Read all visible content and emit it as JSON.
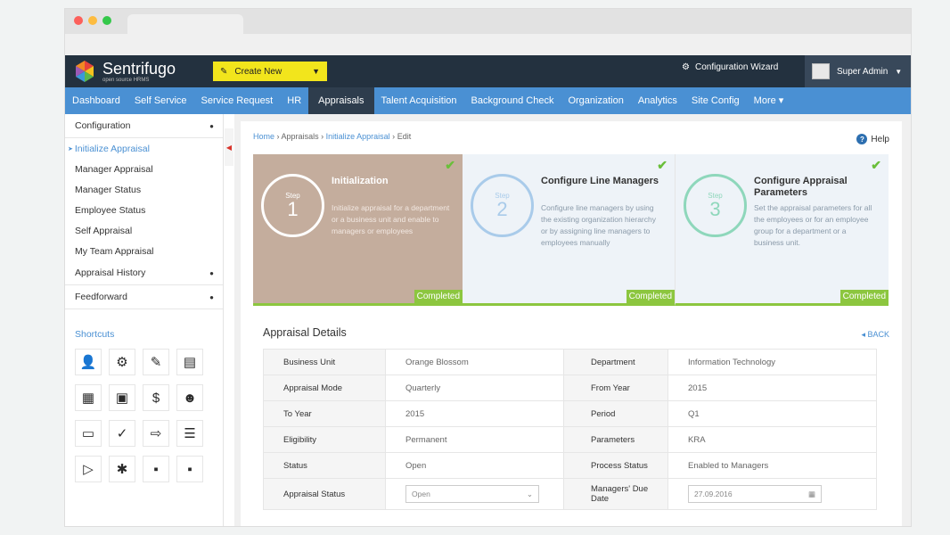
{
  "app": {
    "name": "Sentrifugo",
    "tagline": "open source HRMS"
  },
  "topbar": {
    "create_new": "Create New",
    "wizard": "Configuration Wizard",
    "user": "Super Admin"
  },
  "nav": [
    "Dashboard",
    "Self Service",
    "Service Request",
    "HR",
    "Appraisals",
    "Talent Acquisition",
    "Background Check",
    "Organization",
    "Analytics",
    "Site Config",
    "More ▾"
  ],
  "nav_active": "Appraisals",
  "sidebar": {
    "configuration": "Configuration",
    "initialize": "Initialize Appraisal",
    "items": [
      "Manager Appraisal",
      "Manager Status",
      "Employee Status",
      "Self Appraisal",
      "My Team Appraisal"
    ],
    "history": "Appraisal History",
    "feedforward": "Feedforward",
    "shortcuts": "Shortcuts"
  },
  "breadcrumb": {
    "home": "Home",
    "appraisals": "Appraisals",
    "initialize": "Initialize Appraisal",
    "edit": "Edit",
    "sep": "›"
  },
  "help": "Help",
  "steps": [
    {
      "label": "Step",
      "num": "1",
      "title": "Initialization",
      "desc": "Initialize appraisal for a department or a business unit and enable to managers or employees",
      "status": "Completed"
    },
    {
      "label": "Step",
      "num": "2",
      "title": "Configure Line Managers",
      "desc": "Configure line managers by using the existing organization hierarchy or by assigning line managers to employees manually",
      "status": "Completed"
    },
    {
      "label": "Step",
      "num": "3",
      "title": "Configure Appraisal Parameters",
      "desc": "Set the appraisal parameters for all the employees or for an employee group for a department or a business unit.",
      "status": "Completed"
    }
  ],
  "details": {
    "title": "Appraisal Details",
    "back": "◂ BACK",
    "rows": [
      {
        "l1": "Business Unit",
        "v1": "Orange Blossom",
        "l2": "Department",
        "v2": "Information Technology"
      },
      {
        "l1": "Appraisal Mode",
        "v1": "Quarterly",
        "l2": "From Year",
        "v2": "2015"
      },
      {
        "l1": "To Year",
        "v1": "2015",
        "l2": "Period",
        "v2": "Q1"
      },
      {
        "l1": "Eligibility",
        "v1": "Permanent",
        "l2": "Parameters",
        "v2": "KRA"
      },
      {
        "l1": "Status",
        "v1": "Open",
        "l2": "Process Status",
        "v2": "Enabled to Managers"
      }
    ],
    "status_label": "Appraisal Status",
    "status_value": "Open",
    "due_label": "Managers' Due Date",
    "due_value": "27.09.2016"
  },
  "colors": {
    "navy": "#23313f",
    "nav_blue": "#4a90d3",
    "yellow": "#f2e51c",
    "green": "#8cc63f",
    "step1": "#c4ad9d"
  }
}
